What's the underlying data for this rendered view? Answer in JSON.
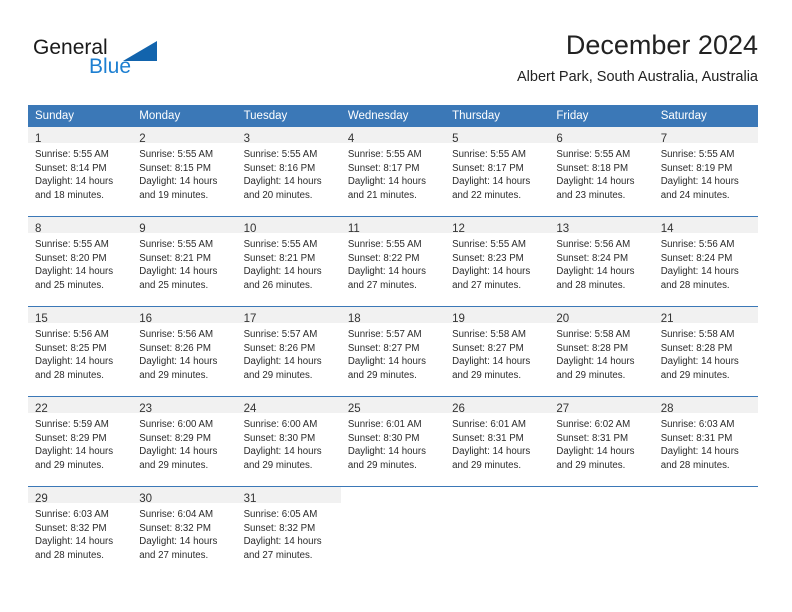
{
  "brand": {
    "name_part1": "General",
    "name_part2": "Blue",
    "accent_color": "#1d7fd1",
    "triangle_color": "#1264ad"
  },
  "header": {
    "title": "December 2024",
    "subtitle": "Albert Park, South Australia, Australia"
  },
  "calendar": {
    "header_bg": "#3b78b7",
    "daynum_bg": "#f1f1f1",
    "weekdays": [
      "Sunday",
      "Monday",
      "Tuesday",
      "Wednesday",
      "Thursday",
      "Friday",
      "Saturday"
    ],
    "weeks": [
      [
        {
          "day": "1",
          "lines": [
            "Sunrise: 5:55 AM",
            "Sunset: 8:14 PM",
            "Daylight: 14 hours",
            "and 18 minutes."
          ]
        },
        {
          "day": "2",
          "lines": [
            "Sunrise: 5:55 AM",
            "Sunset: 8:15 PM",
            "Daylight: 14 hours",
            "and 19 minutes."
          ]
        },
        {
          "day": "3",
          "lines": [
            "Sunrise: 5:55 AM",
            "Sunset: 8:16 PM",
            "Daylight: 14 hours",
            "and 20 minutes."
          ]
        },
        {
          "day": "4",
          "lines": [
            "Sunrise: 5:55 AM",
            "Sunset: 8:17 PM",
            "Daylight: 14 hours",
            "and 21 minutes."
          ]
        },
        {
          "day": "5",
          "lines": [
            "Sunrise: 5:55 AM",
            "Sunset: 8:17 PM",
            "Daylight: 14 hours",
            "and 22 minutes."
          ]
        },
        {
          "day": "6",
          "lines": [
            "Sunrise: 5:55 AM",
            "Sunset: 8:18 PM",
            "Daylight: 14 hours",
            "and 23 minutes."
          ]
        },
        {
          "day": "7",
          "lines": [
            "Sunrise: 5:55 AM",
            "Sunset: 8:19 PM",
            "Daylight: 14 hours",
            "and 24 minutes."
          ]
        }
      ],
      [
        {
          "day": "8",
          "lines": [
            "Sunrise: 5:55 AM",
            "Sunset: 8:20 PM",
            "Daylight: 14 hours",
            "and 25 minutes."
          ]
        },
        {
          "day": "9",
          "lines": [
            "Sunrise: 5:55 AM",
            "Sunset: 8:21 PM",
            "Daylight: 14 hours",
            "and 25 minutes."
          ]
        },
        {
          "day": "10",
          "lines": [
            "Sunrise: 5:55 AM",
            "Sunset: 8:21 PM",
            "Daylight: 14 hours",
            "and 26 minutes."
          ]
        },
        {
          "day": "11",
          "lines": [
            "Sunrise: 5:55 AM",
            "Sunset: 8:22 PM",
            "Daylight: 14 hours",
            "and 27 minutes."
          ]
        },
        {
          "day": "12",
          "lines": [
            "Sunrise: 5:55 AM",
            "Sunset: 8:23 PM",
            "Daylight: 14 hours",
            "and 27 minutes."
          ]
        },
        {
          "day": "13",
          "lines": [
            "Sunrise: 5:56 AM",
            "Sunset: 8:24 PM",
            "Daylight: 14 hours",
            "and 28 minutes."
          ]
        },
        {
          "day": "14",
          "lines": [
            "Sunrise: 5:56 AM",
            "Sunset: 8:24 PM",
            "Daylight: 14 hours",
            "and 28 minutes."
          ]
        }
      ],
      [
        {
          "day": "15",
          "lines": [
            "Sunrise: 5:56 AM",
            "Sunset: 8:25 PM",
            "Daylight: 14 hours",
            "and 28 minutes."
          ]
        },
        {
          "day": "16",
          "lines": [
            "Sunrise: 5:56 AM",
            "Sunset: 8:26 PM",
            "Daylight: 14 hours",
            "and 29 minutes."
          ]
        },
        {
          "day": "17",
          "lines": [
            "Sunrise: 5:57 AM",
            "Sunset: 8:26 PM",
            "Daylight: 14 hours",
            "and 29 minutes."
          ]
        },
        {
          "day": "18",
          "lines": [
            "Sunrise: 5:57 AM",
            "Sunset: 8:27 PM",
            "Daylight: 14 hours",
            "and 29 minutes."
          ]
        },
        {
          "day": "19",
          "lines": [
            "Sunrise: 5:58 AM",
            "Sunset: 8:27 PM",
            "Daylight: 14 hours",
            "and 29 minutes."
          ]
        },
        {
          "day": "20",
          "lines": [
            "Sunrise: 5:58 AM",
            "Sunset: 8:28 PM",
            "Daylight: 14 hours",
            "and 29 minutes."
          ]
        },
        {
          "day": "21",
          "lines": [
            "Sunrise: 5:58 AM",
            "Sunset: 8:28 PM",
            "Daylight: 14 hours",
            "and 29 minutes."
          ]
        }
      ],
      [
        {
          "day": "22",
          "lines": [
            "Sunrise: 5:59 AM",
            "Sunset: 8:29 PM",
            "Daylight: 14 hours",
            "and 29 minutes."
          ]
        },
        {
          "day": "23",
          "lines": [
            "Sunrise: 6:00 AM",
            "Sunset: 8:29 PM",
            "Daylight: 14 hours",
            "and 29 minutes."
          ]
        },
        {
          "day": "24",
          "lines": [
            "Sunrise: 6:00 AM",
            "Sunset: 8:30 PM",
            "Daylight: 14 hours",
            "and 29 minutes."
          ]
        },
        {
          "day": "25",
          "lines": [
            "Sunrise: 6:01 AM",
            "Sunset: 8:30 PM",
            "Daylight: 14 hours",
            "and 29 minutes."
          ]
        },
        {
          "day": "26",
          "lines": [
            "Sunrise: 6:01 AM",
            "Sunset: 8:31 PM",
            "Daylight: 14 hours",
            "and 29 minutes."
          ]
        },
        {
          "day": "27",
          "lines": [
            "Sunrise: 6:02 AM",
            "Sunset: 8:31 PM",
            "Daylight: 14 hours",
            "and 29 minutes."
          ]
        },
        {
          "day": "28",
          "lines": [
            "Sunrise: 6:03 AM",
            "Sunset: 8:31 PM",
            "Daylight: 14 hours",
            "and 28 minutes."
          ]
        }
      ],
      [
        {
          "day": "29",
          "lines": [
            "Sunrise: 6:03 AM",
            "Sunset: 8:32 PM",
            "Daylight: 14 hours",
            "and 28 minutes."
          ]
        },
        {
          "day": "30",
          "lines": [
            "Sunrise: 6:04 AM",
            "Sunset: 8:32 PM",
            "Daylight: 14 hours",
            "and 27 minutes."
          ]
        },
        {
          "day": "31",
          "lines": [
            "Sunrise: 6:05 AM",
            "Sunset: 8:32 PM",
            "Daylight: 14 hours",
            "and 27 minutes."
          ]
        },
        {
          "day": "",
          "lines": []
        },
        {
          "day": "",
          "lines": []
        },
        {
          "day": "",
          "lines": []
        },
        {
          "day": "",
          "lines": []
        }
      ]
    ]
  }
}
